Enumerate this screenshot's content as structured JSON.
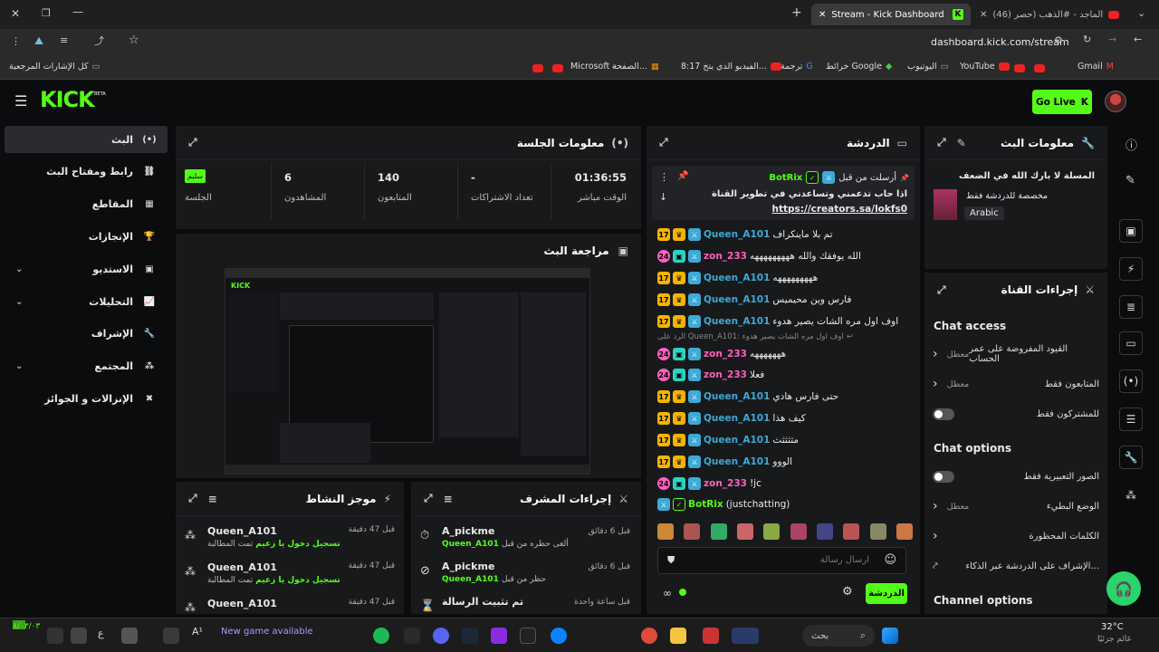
{
  "browser": {
    "tab_active": "Stream - Kick Dashboard",
    "tab_other": "(46) راشد الماجد - #الذهب (حصر",
    "address": "dashboard.kick.com/stream",
    "bookmarks": [
      "Gmail",
      "YouTube",
      "اليوتيوب",
      "خرائط Google",
      "ترجمة",
      "8:17 الفيديو الذي يتخ...",
      "الصفحة...",
      "Microsoft –",
      "كل الإشارات المرجعية"
    ]
  },
  "header": {
    "logo": "KICK",
    "logo_sup": "BETA",
    "go_live": "Go Live"
  },
  "sidebar": {
    "items": [
      {
        "label": "البث",
        "icon": "broadcast-icon",
        "chev": false
      },
      {
        "label": "رابط ومفتاح البث",
        "icon": "link-icon",
        "chev": false
      },
      {
        "label": "المقاطع",
        "icon": "clips-icon",
        "chev": false
      },
      {
        "label": "الإنجازات",
        "icon": "trophy-icon",
        "chev": false
      },
      {
        "label": "الاستديو",
        "icon": "studio-icon",
        "chev": true
      },
      {
        "label": "التحليلات",
        "icon": "analytics-icon",
        "chev": true
      },
      {
        "label": "الإشراف",
        "icon": "wrench-icon",
        "chev": false
      },
      {
        "label": "المجتمع",
        "icon": "community-icon",
        "chev": true
      },
      {
        "label": "الإنزالات و الجوائز",
        "icon": "drops-icon",
        "chev": false
      }
    ]
  },
  "session": {
    "title": "معلومات الجلسة",
    "stats": [
      {
        "value": "01:36:55",
        "label": "الوقت مباشر"
      },
      {
        "value": "-",
        "label": "تعداد الاشتراكات"
      },
      {
        "value": "140",
        "label": "المتابعون"
      },
      {
        "value": "6",
        "label": "المشاهدون"
      },
      {
        "value": "سليم",
        "label": "الجلسة"
      }
    ]
  },
  "preview": {
    "title": "مراجعة البث"
  },
  "activity": {
    "title": "موجز النشاط",
    "items": [
      {
        "user": "Queen_A101",
        "prefix": "تمت المطالبة",
        "action": "تسجيل دخول يا زعيم",
        "time": "قبل 47 دقيقة"
      },
      {
        "user": "Queen_A101",
        "prefix": "تمت المطالبة",
        "action": "تسجيل دخول يا زعيم",
        "time": "قبل 47 دقيقة"
      },
      {
        "user": "Queen_A101",
        "prefix": "",
        "action": "",
        "time": "قبل 47 دقيقة"
      }
    ]
  },
  "modactions": {
    "title": "إجراءات المشرف",
    "items": [
      {
        "user": "A_pickme",
        "detail": "ألغى حظره من قبل",
        "by": "Queen_A101",
        "time": "قبل 6 دقائق"
      },
      {
        "user": "A_pickme",
        "detail": "حظر من قبل",
        "by": "Queen_A101",
        "time": "قبل 6 دقائق"
      },
      {
        "user": "تم تثبيت الرسالة",
        "detail": "",
        "by": "",
        "time": "قبل ساعة واحدة"
      }
    ]
  },
  "chat": {
    "title": "الدردشة",
    "pinned": {
      "label": "أرسلت من قبل",
      "user": "BotRix",
      "text": "اذا حاب تدعمني وتساعدني في تطوير القناة",
      "link": "https://creators.sa/lokfs0"
    },
    "messages": [
      {
        "badge": "17",
        "user": "Queen_A101",
        "text": "تم بلا ماينكراف",
        "type": "q"
      },
      {
        "badge": "24",
        "user": "zon_233",
        "text": "الله يوفقك والله هههههههههه",
        "type": "z"
      },
      {
        "badge": "17",
        "user": "Queen_A101",
        "text": "هههههههههه",
        "type": "q"
      },
      {
        "badge": "17",
        "user": "Queen_A101",
        "text": "فارس وين محيميس",
        "type": "q"
      },
      {
        "badge": "17",
        "user": "Queen_A101",
        "text": "اوف اول مره الشات يصير هدوء",
        "type": "q"
      },
      {
        "badge": "reply",
        "user": "",
        "text": "الرد على Queen_A101: اوف اول مره الشات يصير هدوء",
        "type": "r"
      },
      {
        "badge": "24",
        "user": "zon_233",
        "text": "هههههههه",
        "type": "z"
      },
      {
        "badge": "24",
        "user": "zon_233",
        "text": "فعلا",
        "type": "z"
      },
      {
        "badge": "17",
        "user": "Queen_A101",
        "text": "حتى فارس هادي",
        "type": "q"
      },
      {
        "badge": "17",
        "user": "Queen_A101",
        "text": "كيف هذا",
        "type": "q"
      },
      {
        "badge": "17",
        "user": "Queen_A101",
        "text": "مثثثثث",
        "type": "q"
      },
      {
        "badge": "17",
        "user": "Queen_A101",
        "text": "الووو",
        "type": "q"
      },
      {
        "badge": "24",
        "user": "zon_233",
        "text": "!jc",
        "type": "z"
      },
      {
        "badge": "",
        "user": "BotRix",
        "text": "(justchatting)",
        "type": "b"
      }
    ],
    "placeholder": "ارسال رسالة",
    "send": "الدردشة"
  },
  "streaminfo": {
    "title": "معلومات البث",
    "stream_title": "المسلة لا بارك الله في الضعف",
    "subtitle": "مخصصة للدردشة فقط",
    "language": "Arabic"
  },
  "channel_actions": {
    "title": "إجراءات القناة",
    "chat_access": "Chat access",
    "rows1": [
      {
        "label": "القيود المفروضة على عمر الحساب",
        "value": "معطل",
        "ctl": "chev"
      },
      {
        "label": "المتابعون فقط",
        "value": "معطل",
        "ctl": "chev"
      },
      {
        "label": "للمشتركون فقط",
        "value": "",
        "ctl": "toggle"
      }
    ],
    "chat_options": "Chat options",
    "rows2": [
      {
        "label": "الصور التعبيرية فقط",
        "value": "",
        "ctl": "toggle"
      },
      {
        "label": "الوضع البطيء",
        "value": "معطل",
        "ctl": "chev"
      },
      {
        "label": "الكلمات المحظورة",
        "value": "",
        "ctl": "chev"
      },
      {
        "label": "الإشراف على الدردشة عبر الذكاء...",
        "value": "",
        "ctl": "ext"
      }
    ],
    "channel_options": "Channel options"
  },
  "taskbar": {
    "search": "بحث",
    "weather": "32°C",
    "weather_sub": "غائم جزئيًا",
    "news": "New game available",
    "date": "٨/٠٣/٠٣"
  },
  "colors": {
    "accent": "#53fc18",
    "panel": "#18191b",
    "bg": "#0b0c0d"
  }
}
